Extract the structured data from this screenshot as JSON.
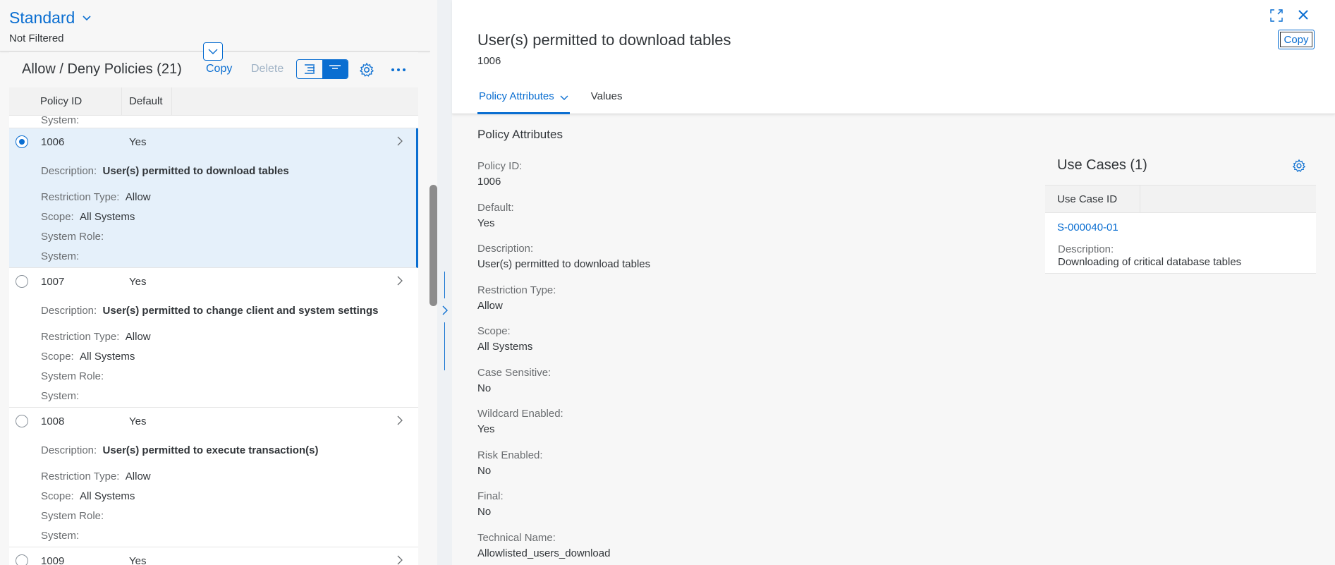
{
  "variant": {
    "title": "Standard",
    "subtitle": "Not Filtered"
  },
  "list": {
    "title": "Allow / Deny Policies (21)",
    "copy_label": "Copy",
    "delete_label": "Delete",
    "columns": [
      "Policy ID",
      "Default"
    ],
    "partial_top_label": "System:",
    "rows": [
      {
        "id": "1006",
        "default": "Yes",
        "selected": true,
        "description_label": "Description:",
        "description": "User(s) permitted to download tables",
        "restriction_label": "Restriction Type:",
        "restriction": "Allow",
        "scope_label": "Scope:",
        "scope": "All Systems",
        "system_role_label": "System Role:",
        "system_label": "System:"
      },
      {
        "id": "1007",
        "default": "Yes",
        "selected": false,
        "description_label": "Description:",
        "description": "User(s) permitted to change client and system settings",
        "restriction_label": "Restriction Type:",
        "restriction": "Allow",
        "scope_label": "Scope:",
        "scope": "All Systems",
        "system_role_label": "System Role:",
        "system_label": "System:"
      },
      {
        "id": "1008",
        "default": "Yes",
        "selected": false,
        "description_label": "Description:",
        "description": "User(s) permitted to execute transaction(s)",
        "restriction_label": "Restriction Type:",
        "restriction": "Allow",
        "scope_label": "Scope:",
        "scope": "All Systems",
        "system_role_label": "System Role:",
        "system_label": "System:"
      },
      {
        "id": "1009",
        "default": "Yes",
        "selected": false
      }
    ]
  },
  "detail": {
    "title": "User(s) permitted to download tables",
    "subtitle": "1006",
    "copy_label": "Copy",
    "tabs": [
      "Policy Attributes",
      "Values"
    ],
    "section_title": "Policy Attributes",
    "attributes": [
      {
        "label": "Policy ID:",
        "value": "1006"
      },
      {
        "label": "Default:",
        "value": "Yes"
      },
      {
        "label": "Description:",
        "value": "User(s) permitted to download tables"
      },
      {
        "label": "Restriction Type:",
        "value": "Allow"
      },
      {
        "label": "Scope:",
        "value": "All Systems"
      },
      {
        "label": "Case Sensitive:",
        "value": "No"
      },
      {
        "label": "Wildcard Enabled:",
        "value": "Yes"
      },
      {
        "label": "Risk Enabled:",
        "value": "No"
      },
      {
        "label": "Final:",
        "value": "No"
      },
      {
        "label": "Technical Name:",
        "value": "Allowlisted_users_download"
      }
    ],
    "use_cases": {
      "title": "Use Cases (1)",
      "column": "Use Case ID",
      "items": [
        {
          "id": "S-000040-01",
          "description_label": "Description:",
          "description": "Downloading of critical database tables"
        }
      ]
    }
  },
  "colors": {
    "accent": "#0a6ed1",
    "selected_row": "#e5f0fa",
    "text": "#32363a",
    "label": "#6a6d70"
  }
}
